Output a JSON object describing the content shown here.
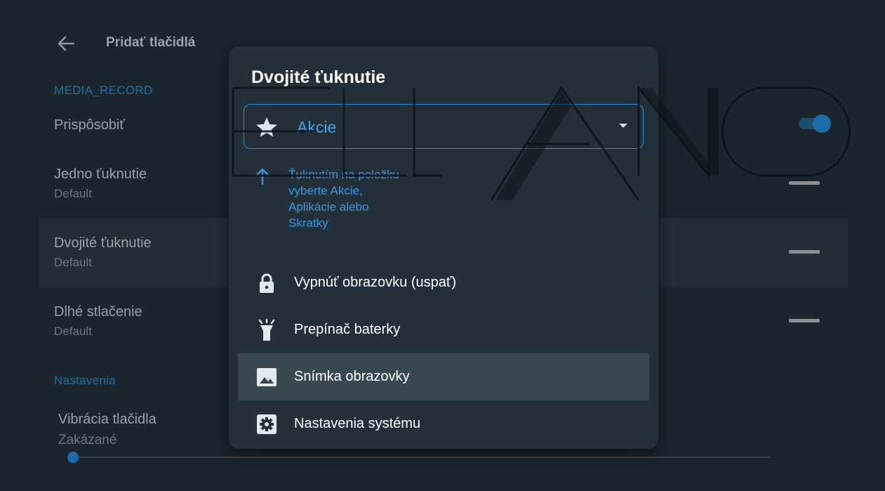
{
  "page": {
    "title": "Pridať tlačidlá",
    "section_media": "MEDIA_RECORD",
    "customize_label": "Prispôsobiť",
    "rows": [
      {
        "title": "Jedno ťuknutie",
        "subtitle": "Default"
      },
      {
        "title": "Dvojité ťuknutie",
        "subtitle": "Default"
      },
      {
        "title": "Dlhé stlačenie",
        "subtitle": "Default"
      }
    ],
    "section_settings": "Nastavenia",
    "vibration": {
      "title": "Vibrácia tlačidla",
      "value": "Zakázané",
      "level": 0
    }
  },
  "dialog": {
    "title": "Dvojité ťuknutie",
    "select": {
      "icon": "star-icon",
      "value": "Akcie"
    },
    "hint": "Ťuknutím na položku vyberte Akcie, Aplikácie alebo Skratky",
    "items": [
      {
        "icon": "lock-icon",
        "label": "Vypnúť obrazovku (uspať)"
      },
      {
        "icon": "flashlight-icon",
        "label": "Prepínač baterky"
      },
      {
        "icon": "image-icon",
        "label": "Snímka obrazovky"
      },
      {
        "icon": "gear-icon",
        "label": "Nastavenia systému"
      }
    ]
  },
  "colors": {
    "accent": "#2f8fd8",
    "background": "#1b252d",
    "dialog_bg": "#233039",
    "highlight": "#3a4851"
  }
}
